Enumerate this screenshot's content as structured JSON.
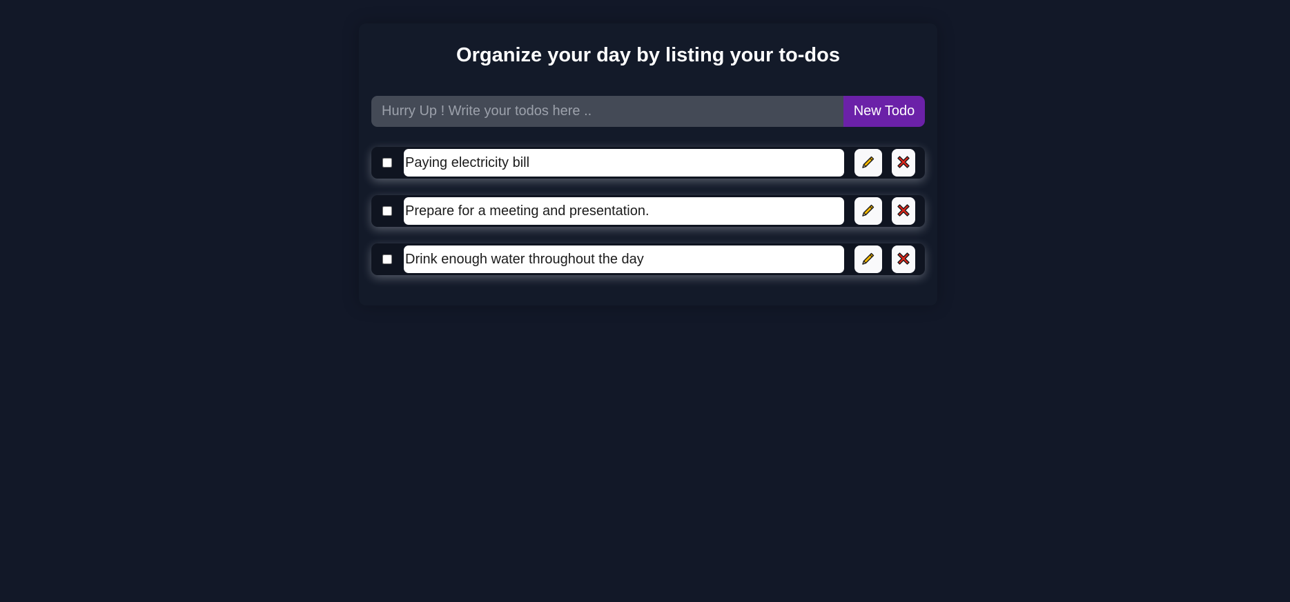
{
  "header": {
    "title": "Organize your day by listing your to-dos"
  },
  "new_todo": {
    "placeholder": "Hurry Up ! Write your todos here ..",
    "value": "",
    "button_label": "New Todo"
  },
  "todos": [
    {
      "text": "Paying electricity bill",
      "completed": false
    },
    {
      "text": "Prepare for a meeting and presentation.",
      "completed": false
    },
    {
      "text": "Drink enough water throughout the day",
      "completed": false
    }
  ],
  "icons": {
    "edit": "pencil-icon",
    "delete": "cross-icon"
  },
  "colors": {
    "background": "#121828",
    "accent": "#6b21a8",
    "input_bg": "#444a56",
    "delete_red": "#e0261b",
    "pencil_yellow": "#f5b800"
  }
}
